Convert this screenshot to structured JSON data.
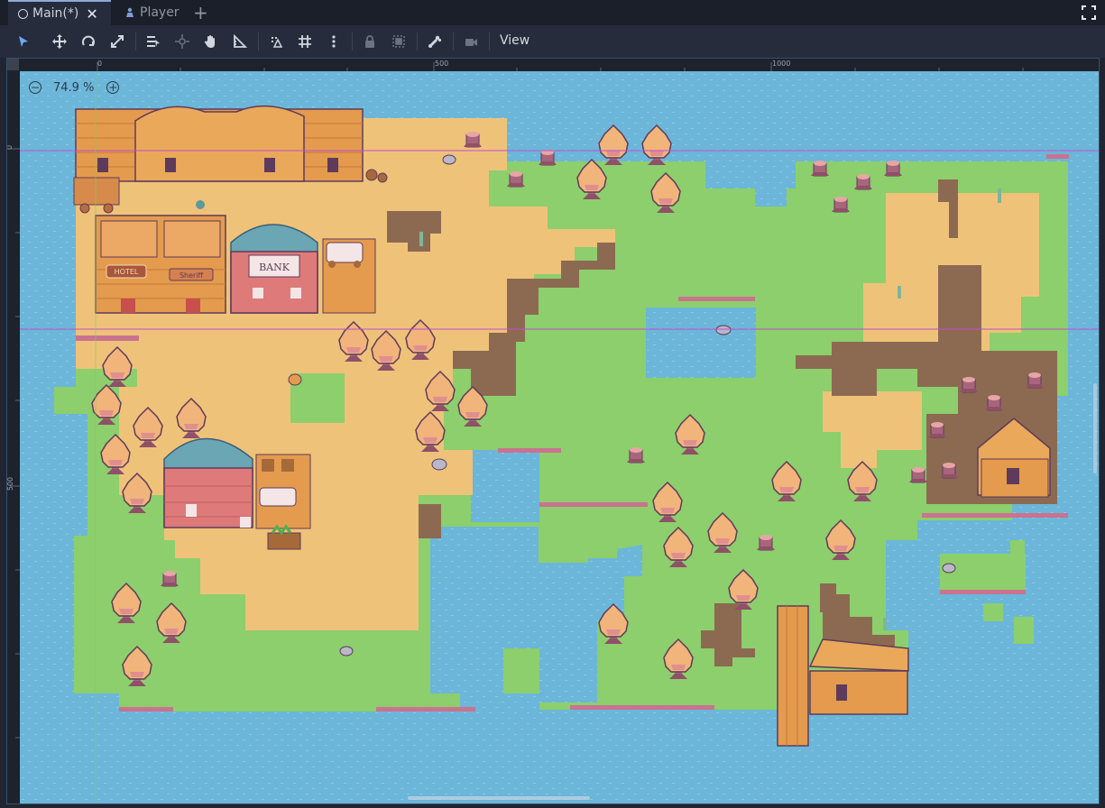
{
  "tabs": {
    "main_label": "Main(*)",
    "player_label": "Player",
    "add_symbol": "+",
    "close_symbol": "✕"
  },
  "toolbar": {
    "view_label": "View",
    "tools": [
      "select-icon",
      "move-icon",
      "rotate-icon",
      "scale-icon",
      "list-select-icon",
      "pivot-icon",
      "pan-icon",
      "ruler-icon",
      "smart-snap-icon",
      "grid-snap-icon",
      "more-icon",
      "lock-icon",
      "group-icon",
      "skeleton-icon",
      "camera-icon"
    ]
  },
  "rulers": {
    "top": [
      "0",
      "500",
      "1000"
    ],
    "left": [
      "0",
      "500"
    ]
  },
  "zoom": {
    "level": "74.9 %",
    "minus": "−",
    "plus": "+"
  },
  "map": {
    "signs": {
      "hotel": "HOTEL",
      "sheriff": "Sheriff",
      "bank": "BANK"
    },
    "colors": {
      "water": "#6bb6d9",
      "grass": "#8ccf6c",
      "sand": "#efc27a",
      "dirt": "#8c6a52",
      "tree": "#f1b47a",
      "trunk": "#a8657c",
      "wood": "#e49b4e",
      "roof_blue": "#6ba6b5",
      "wall_red": "#de7a7a",
      "guide": "#c24ecc"
    }
  }
}
